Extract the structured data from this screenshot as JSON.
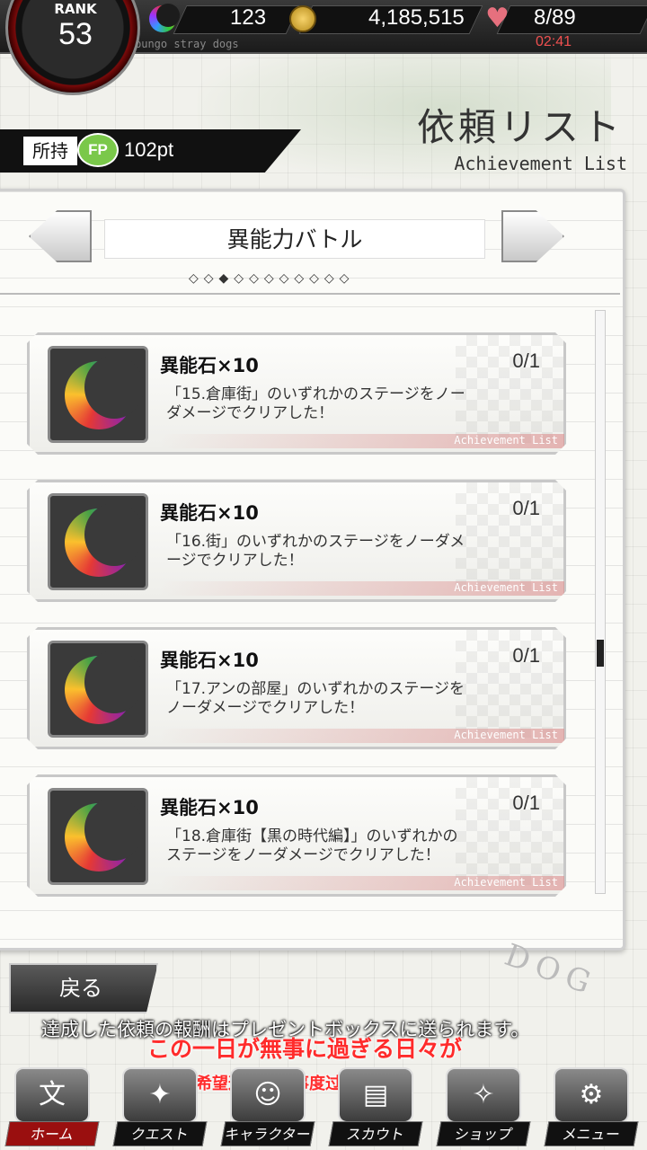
{
  "status": {
    "rank_label": "RANK",
    "rank_value": "53",
    "ability_stones": "123",
    "coins": "4,185,515",
    "ap": "8/89",
    "game_name": "bungo stray dogs",
    "timer": "02:41"
  },
  "header": {
    "title": "依頼リスト",
    "subtitle": "Achievement List"
  },
  "fp": {
    "own_label": "所持",
    "badge": "FP",
    "value": "102pt"
  },
  "category": {
    "name": "異能力バトル",
    "dots": "◇◇◆◇◇◇◇◇◇◇◇"
  },
  "missions": [
    {
      "reward": "異能石×10",
      "progress": "0/1",
      "description": "「15.倉庫街」のいずれかのステージをノーダメージでクリアした！",
      "footer": "Achievement List"
    },
    {
      "reward": "異能石×10",
      "progress": "0/1",
      "description": "「16.街」のいずれかのステージをノーダメージでクリアした！",
      "footer": "Achievement List"
    },
    {
      "reward": "異能石×10",
      "progress": "0/1",
      "description": "「17.アンの部屋」のいずれかのステージをノーダメージでクリアした！",
      "footer": "Achievement List"
    },
    {
      "reward": "異能石×10",
      "progress": "0/1",
      "description": "「18.倉庫街【黒の時代編】」のいずれかのステージをノーダメージでクリアした！",
      "footer": "Achievement List"
    }
  ],
  "back_label": "戻る",
  "deco": "DOG",
  "notice": "達成した依頼の報酬はプレゼントボックスに送られます。",
  "subtitles": {
    "jp": "この一日が無事に過ぎる日々が",
    "cn": "希望这一日无事度过的生活"
  },
  "nav": [
    {
      "label": "ホーム",
      "glyph": "文"
    },
    {
      "label": "クエスト",
      "glyph": "✦"
    },
    {
      "label": "キャラクター",
      "glyph": "☺"
    },
    {
      "label": "スカウト",
      "glyph": "▤"
    },
    {
      "label": "ショップ",
      "glyph": "✧"
    },
    {
      "label": "メニュー",
      "glyph": "⚙"
    }
  ]
}
